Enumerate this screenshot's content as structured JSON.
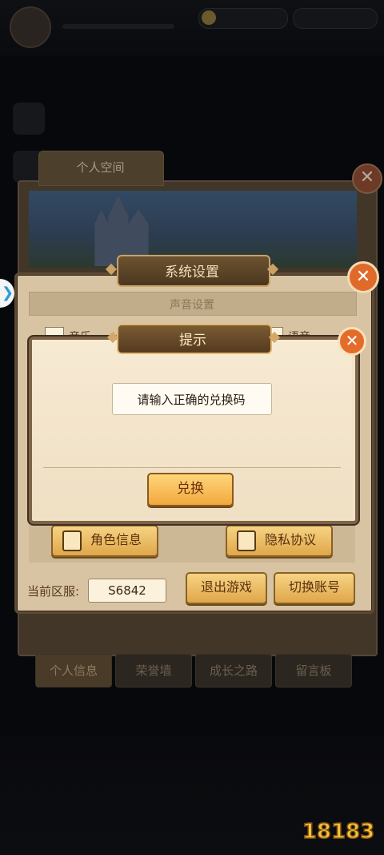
{
  "top_bar": {
    "player_name": "",
    "player_id": "",
    "coins": "",
    "gems": ""
  },
  "personal_space": {
    "tab_label": "个人空间",
    "bottom_tabs": [
      "个人信息",
      "荣誉墙",
      "成长之路",
      "留言板"
    ]
  },
  "system_settings": {
    "title": "系统设置",
    "sound_section": "声音设置",
    "music_label": "音乐",
    "voice_label": "语音",
    "role_info_button": "角色信息",
    "privacy_button": "隐私协议",
    "server_label": "当前区服:",
    "server_value": "S6842",
    "exit_button": "退出游戏",
    "switch_account_button": "切换账号"
  },
  "tip_dialog": {
    "title": "提示",
    "message": "请输入正确的兑换码",
    "confirm_button": "兑换"
  },
  "icons": {
    "close": "close-icon",
    "edge_arrow": "chevron-right-icon"
  },
  "watermark": "18183",
  "colors": {
    "accent_gold": "#f2a83e",
    "panel_bg": "#d8c4a3",
    "close_orange": "#e06a2a"
  }
}
